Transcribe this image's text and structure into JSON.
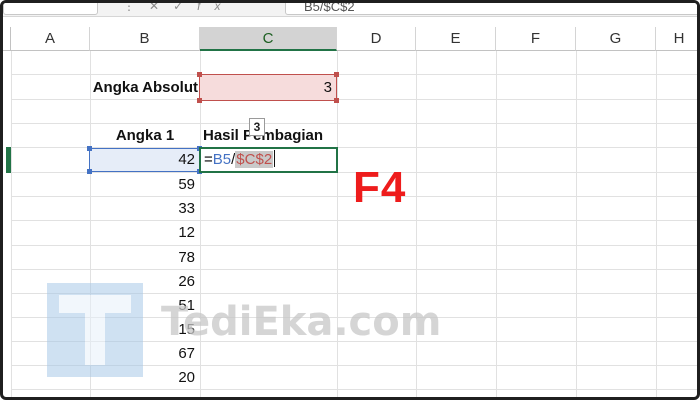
{
  "formula_bar": {
    "formula": "B5/$C$2",
    "icons": [
      "more-icon",
      "cancel-icon",
      "confirm-icon",
      "fx-icon"
    ]
  },
  "columns": [
    "A",
    "B",
    "C",
    "D",
    "E",
    "F",
    "G",
    "H"
  ],
  "active_column": "C",
  "cells": {
    "B2": "Angka Absolut",
    "C2": "3",
    "B4": "Angka 1",
    "C4": "Hasil Pembagian",
    "B_values": [
      "42",
      "59",
      "33",
      "12",
      "78",
      "26",
      "51",
      "15",
      "67",
      "20"
    ]
  },
  "editing": {
    "equals": "=",
    "ref1": "B5",
    "operator": "/",
    "ref2": "$C$2"
  },
  "tooltip_value": "3",
  "hotkey_label": "F4",
  "watermark": {
    "logo_letter": "T",
    "text": "TediEka.com"
  },
  "colors": {
    "accent_green": "#217346",
    "ref_red": "#c0504d",
    "ref_blue": "#4472c4",
    "hotkey_red": "#ee1c1c"
  }
}
